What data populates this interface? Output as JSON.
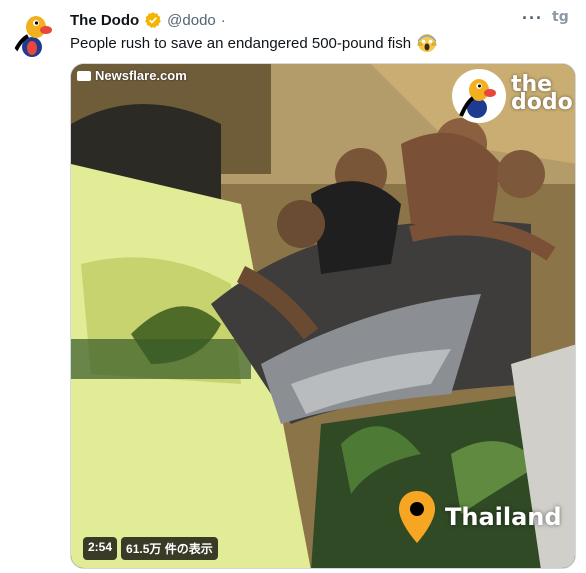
{
  "author": {
    "name": "The Dodo",
    "handle": "@dodo",
    "separator": "·",
    "verified": true,
    "avatar_icon": "dodo-bird-icon"
  },
  "actions": {
    "more_label": "···",
    "brand_label": "tg"
  },
  "tweet": {
    "text": "People rush to save an endangered 500-pound fish",
    "emoji_icon": "screaming-face-emoji-icon"
  },
  "media": {
    "watermark": "Newsflare.com",
    "logo_text": "the dodo",
    "location": "Thailand",
    "duration": "2:54",
    "views": "61.5万 件の表示"
  },
  "colors": {
    "verified_badge": "#f4b400",
    "pin": "#f6a623",
    "handle_text": "#536471"
  }
}
